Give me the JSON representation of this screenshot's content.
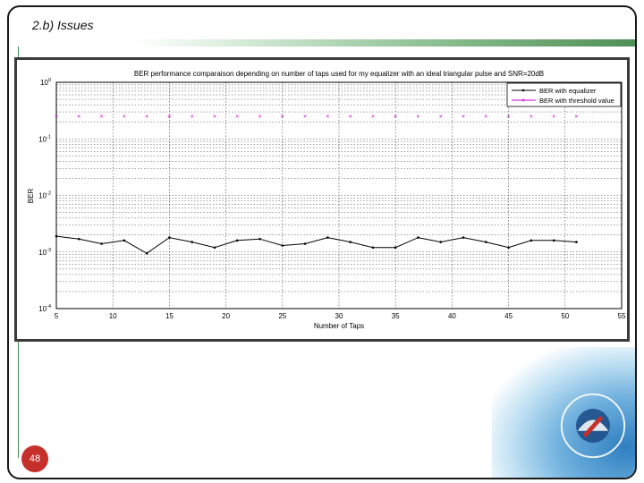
{
  "slide": {
    "title": "2.b) Issues",
    "page_number": "48",
    "logo_text": "UNIVERSITY OF PLYMOUTH"
  },
  "chart_data": {
    "type": "line",
    "title": "BER performance comparaison depending on number of taps used for my equalizer with an ideal triangular pulse and SNR=20dB",
    "xlabel": "Number of Taps",
    "ylabel": "BER",
    "xlim": [
      5,
      55
    ],
    "ylim": [
      0.0001,
      1
    ],
    "yscale": "log",
    "grid": true,
    "legend_position": "top-right",
    "xticks": [
      5,
      10,
      15,
      20,
      25,
      30,
      35,
      40,
      45,
      50,
      55
    ],
    "yticks": [
      {
        "value": 1,
        "base": "10",
        "exp": "0"
      },
      {
        "value": 0.1,
        "base": "10",
        "exp": "-1"
      },
      {
        "value": 0.01,
        "base": "10",
        "exp": "-2"
      },
      {
        "value": 0.001,
        "base": "10",
        "exp": "-3"
      },
      {
        "value": 0.0001,
        "base": "10",
        "exp": "-4"
      }
    ],
    "series": [
      {
        "name": "BER with equalizer",
        "color": "#000000",
        "marker": "dot",
        "x": [
          5,
          7,
          9,
          11,
          13,
          15,
          17,
          19,
          21,
          23,
          25,
          27,
          29,
          31,
          33,
          35,
          37,
          39,
          41,
          43,
          45,
          47,
          49,
          51
        ],
        "y": [
          0.0019,
          0.0017,
          0.0014,
          0.0016,
          0.00095,
          0.0018,
          0.0015,
          0.0012,
          0.0016,
          0.0017,
          0.0013,
          0.0014,
          0.0018,
          0.0015,
          0.0012,
          0.0012,
          0.0018,
          0.0015,
          0.0018,
          0.0015,
          0.0012,
          0.0016,
          0.0016,
          0.0015
        ]
      },
      {
        "name": "BER with threshold value",
        "color": "#cc00cc",
        "marker": "x",
        "x": [
          5,
          7,
          9,
          11,
          13,
          15,
          17,
          19,
          21,
          23,
          25,
          27,
          29,
          31,
          33,
          35,
          37,
          39,
          41,
          43,
          45,
          47,
          49,
          51
        ],
        "y": [
          0.25,
          0.25,
          0.25,
          0.25,
          0.25,
          0.25,
          0.25,
          0.25,
          0.25,
          0.25,
          0.25,
          0.25,
          0.25,
          0.25,
          0.25,
          0.25,
          0.25,
          0.25,
          0.25,
          0.25,
          0.25,
          0.25,
          0.25,
          0.25
        ]
      }
    ]
  }
}
